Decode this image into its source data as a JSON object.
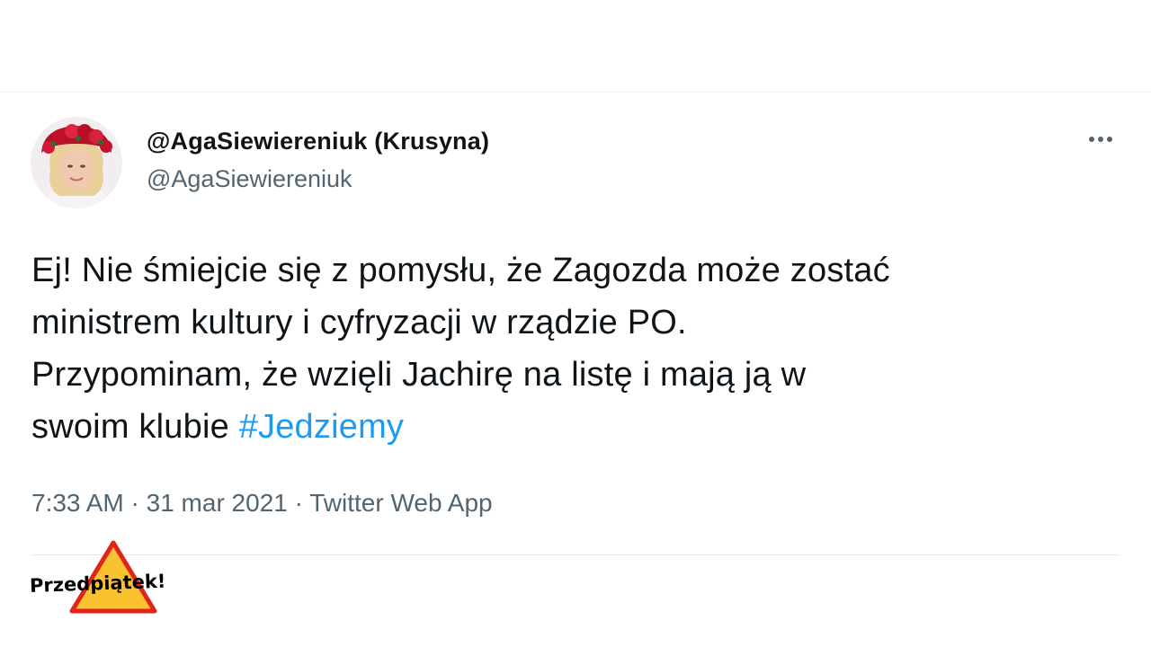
{
  "tweet": {
    "author": {
      "display_name": "@AgaSiewiereniuk (Krusyna)",
      "handle": "@AgaSiewiereniuk"
    },
    "text_lines": [
      "Ej! Nie śmiejcie się z pomysłu, że Zagozda może zostać",
      "ministrem kultury i cyfryzacji w rządzie PO.",
      "Przypominam, że wzięli Jachirę na listę i mają ją w",
      "swoim klubie "
    ],
    "hashtag": "#Jedziemy",
    "time": "7:33 AM",
    "date": "31 mar 2021",
    "separator": " · ",
    "source": "Twitter Web App",
    "more_icon": "more-horizontal-icon"
  },
  "overlay": {
    "label": "Przedpiątek!",
    "icon": "warning-triangle-icon"
  },
  "colors": {
    "text": "#0f1419",
    "secondary": "#536471",
    "link": "#1d9bf0",
    "warning_fill": "#f9c22e",
    "warning_border": "#e0241b"
  }
}
